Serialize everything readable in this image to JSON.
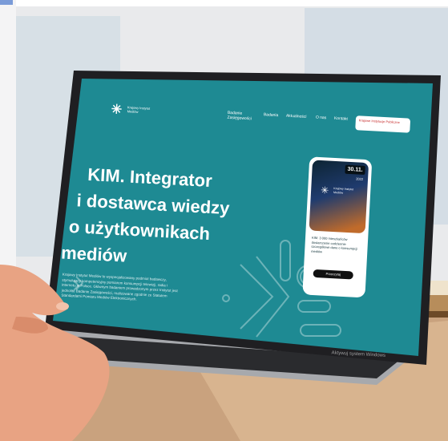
{
  "nav": {
    "logo_text": "Krajowy Instytut Mediów",
    "items": [
      "Badanie Zasięgowości",
      "Badania",
      "Aktualności",
      "O nas",
      "Kontakt"
    ],
    "badge": "Krajowe Instytucje Publiczne"
  },
  "hero": {
    "line1": "KIM. Integrator",
    "line2": "i dostawca wiedzy",
    "line3": "o użytkownikach",
    "line4": "mediów"
  },
  "description": "Krajowy Instytut Mediów to wyspecjalizowany podmiot badawczy, stymulujący kompetencyjny pomiarem konsumpcji telewizji, radia i internetu w Polsce. Głównym badaniem prowadzonym przez Instytut jest jednolite Badanie Zasięgowości, realizowane zgodnie ze Statutem Standardami Pomiaru Mediów Elektronicznych.",
  "card": {
    "date": "30.11.",
    "year": "2022",
    "logo_text": "Krajowy Instytut Mediów",
    "text": "KIM. 3 000 mieszkańców dostarczenie codziennie szczegółowe dane o konsumpcji mediów",
    "button": "Przeczytaj",
    "link": "Zobacz wszystkie"
  },
  "watermark": "Aktywuj system Windows",
  "colors": {
    "site_teal": "#1e8a93",
    "laptop_frame": "#1f1f22",
    "desk_wood": "#c9a27e"
  }
}
